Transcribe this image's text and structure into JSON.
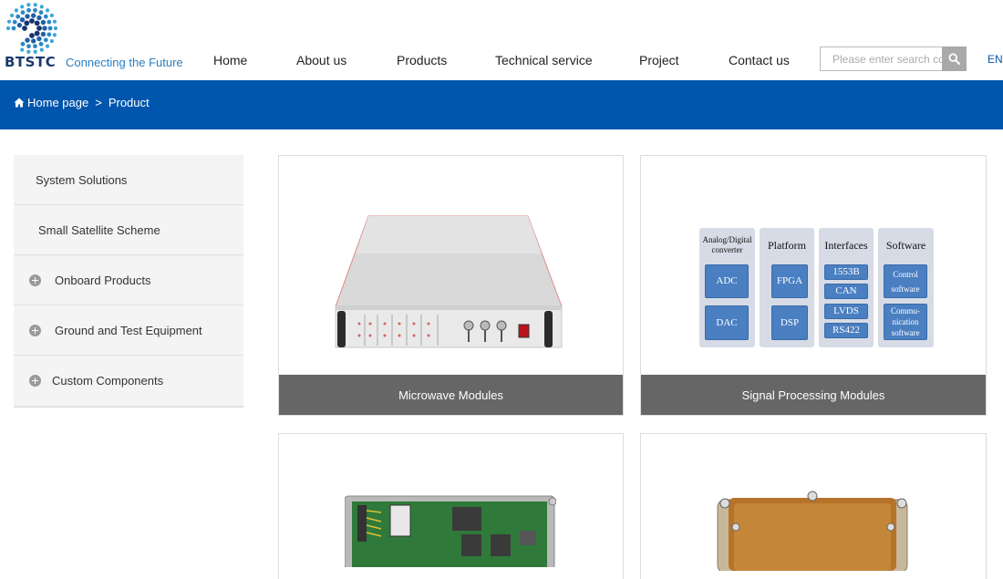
{
  "brand": {
    "name": "BTSTC",
    "slogan": "Connecting the Future"
  },
  "nav": {
    "items": [
      {
        "label": "Home"
      },
      {
        "label": "About us"
      },
      {
        "label": "Products"
      },
      {
        "label": "Technical service"
      },
      {
        "label": "Project"
      },
      {
        "label": "Contact us"
      }
    ]
  },
  "search": {
    "placeholder": "Please enter search content"
  },
  "language": "EN",
  "breadcrumb": {
    "home": "Home page",
    "separator": ">",
    "current": "Product"
  },
  "sidebar": {
    "items": [
      {
        "label": "System Solutions",
        "expandable": false
      },
      {
        "label": "Small Satellite Scheme",
        "expandable": false
      },
      {
        "label": "Onboard Products",
        "expandable": true
      },
      {
        "label": "Ground and Test Equipment",
        "expandable": true
      },
      {
        "label": "Custom Components",
        "expandable": true
      }
    ]
  },
  "products": {
    "cards": [
      {
        "title": "Microwave Modules"
      },
      {
        "title": "Signal Processing Modules"
      }
    ]
  },
  "signal_diagram": {
    "columns": [
      {
        "header": "Analog/Digital converter",
        "items": [
          "ADC",
          "DAC"
        ]
      },
      {
        "header": "Platform",
        "items": [
          "FPGA",
          "DSP"
        ]
      },
      {
        "header": "Interfaces",
        "items": [
          "1553B",
          "CAN",
          "LVDS",
          "RS422"
        ]
      },
      {
        "header": "Software",
        "items": [
          "Control software",
          "Commu-nication software"
        ]
      }
    ]
  },
  "colors": {
    "banner": "#0055ac",
    "caption_bg": "#666666",
    "diagram_button": "#4a7fc1",
    "diagram_panel": "#d6dbe6"
  },
  "icons": {
    "home": "home-icon",
    "search": "search-icon",
    "expand": "plus-circle-icon"
  }
}
